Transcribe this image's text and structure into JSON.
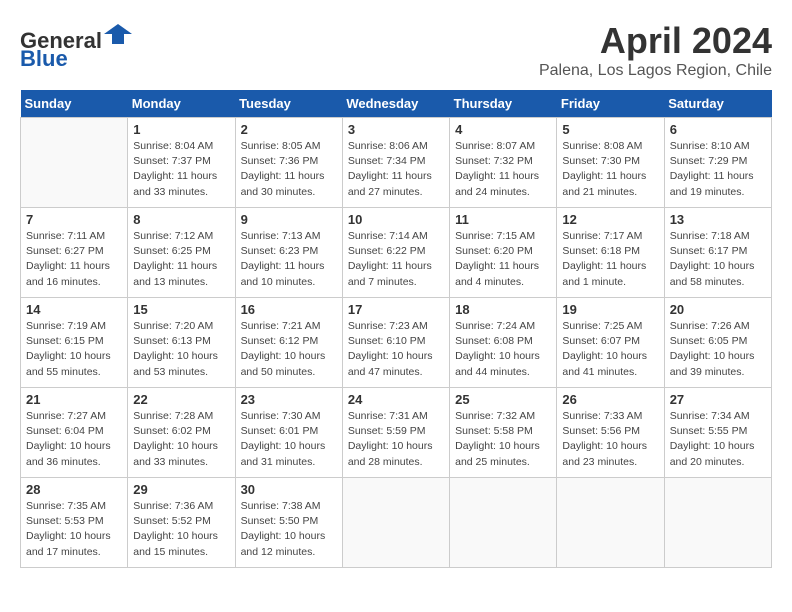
{
  "header": {
    "logo_line1": "General",
    "logo_line2": "Blue",
    "month": "April 2024",
    "location": "Palena, Los Lagos Region, Chile"
  },
  "weekdays": [
    "Sunday",
    "Monday",
    "Tuesday",
    "Wednesday",
    "Thursday",
    "Friday",
    "Saturday"
  ],
  "weeks": [
    [
      {
        "day": "",
        "info": ""
      },
      {
        "day": "1",
        "info": "Sunrise: 8:04 AM\nSunset: 7:37 PM\nDaylight: 11 hours\nand 33 minutes."
      },
      {
        "day": "2",
        "info": "Sunrise: 8:05 AM\nSunset: 7:36 PM\nDaylight: 11 hours\nand 30 minutes."
      },
      {
        "day": "3",
        "info": "Sunrise: 8:06 AM\nSunset: 7:34 PM\nDaylight: 11 hours\nand 27 minutes."
      },
      {
        "day": "4",
        "info": "Sunrise: 8:07 AM\nSunset: 7:32 PM\nDaylight: 11 hours\nand 24 minutes."
      },
      {
        "day": "5",
        "info": "Sunrise: 8:08 AM\nSunset: 7:30 PM\nDaylight: 11 hours\nand 21 minutes."
      },
      {
        "day": "6",
        "info": "Sunrise: 8:10 AM\nSunset: 7:29 PM\nDaylight: 11 hours\nand 19 minutes."
      }
    ],
    [
      {
        "day": "7",
        "info": "Sunrise: 7:11 AM\nSunset: 6:27 PM\nDaylight: 11 hours\nand 16 minutes."
      },
      {
        "day": "8",
        "info": "Sunrise: 7:12 AM\nSunset: 6:25 PM\nDaylight: 11 hours\nand 13 minutes."
      },
      {
        "day": "9",
        "info": "Sunrise: 7:13 AM\nSunset: 6:23 PM\nDaylight: 11 hours\nand 10 minutes."
      },
      {
        "day": "10",
        "info": "Sunrise: 7:14 AM\nSunset: 6:22 PM\nDaylight: 11 hours\nand 7 minutes."
      },
      {
        "day": "11",
        "info": "Sunrise: 7:15 AM\nSunset: 6:20 PM\nDaylight: 11 hours\nand 4 minutes."
      },
      {
        "day": "12",
        "info": "Sunrise: 7:17 AM\nSunset: 6:18 PM\nDaylight: 11 hours\nand 1 minute."
      },
      {
        "day": "13",
        "info": "Sunrise: 7:18 AM\nSunset: 6:17 PM\nDaylight: 10 hours\nand 58 minutes."
      }
    ],
    [
      {
        "day": "14",
        "info": "Sunrise: 7:19 AM\nSunset: 6:15 PM\nDaylight: 10 hours\nand 55 minutes."
      },
      {
        "day": "15",
        "info": "Sunrise: 7:20 AM\nSunset: 6:13 PM\nDaylight: 10 hours\nand 53 minutes."
      },
      {
        "day": "16",
        "info": "Sunrise: 7:21 AM\nSunset: 6:12 PM\nDaylight: 10 hours\nand 50 minutes."
      },
      {
        "day": "17",
        "info": "Sunrise: 7:23 AM\nSunset: 6:10 PM\nDaylight: 10 hours\nand 47 minutes."
      },
      {
        "day": "18",
        "info": "Sunrise: 7:24 AM\nSunset: 6:08 PM\nDaylight: 10 hours\nand 44 minutes."
      },
      {
        "day": "19",
        "info": "Sunrise: 7:25 AM\nSunset: 6:07 PM\nDaylight: 10 hours\nand 41 minutes."
      },
      {
        "day": "20",
        "info": "Sunrise: 7:26 AM\nSunset: 6:05 PM\nDaylight: 10 hours\nand 39 minutes."
      }
    ],
    [
      {
        "day": "21",
        "info": "Sunrise: 7:27 AM\nSunset: 6:04 PM\nDaylight: 10 hours\nand 36 minutes."
      },
      {
        "day": "22",
        "info": "Sunrise: 7:28 AM\nSunset: 6:02 PM\nDaylight: 10 hours\nand 33 minutes."
      },
      {
        "day": "23",
        "info": "Sunrise: 7:30 AM\nSunset: 6:01 PM\nDaylight: 10 hours\nand 31 minutes."
      },
      {
        "day": "24",
        "info": "Sunrise: 7:31 AM\nSunset: 5:59 PM\nDaylight: 10 hours\nand 28 minutes."
      },
      {
        "day": "25",
        "info": "Sunrise: 7:32 AM\nSunset: 5:58 PM\nDaylight: 10 hours\nand 25 minutes."
      },
      {
        "day": "26",
        "info": "Sunrise: 7:33 AM\nSunset: 5:56 PM\nDaylight: 10 hours\nand 23 minutes."
      },
      {
        "day": "27",
        "info": "Sunrise: 7:34 AM\nSunset: 5:55 PM\nDaylight: 10 hours\nand 20 minutes."
      }
    ],
    [
      {
        "day": "28",
        "info": "Sunrise: 7:35 AM\nSunset: 5:53 PM\nDaylight: 10 hours\nand 17 minutes."
      },
      {
        "day": "29",
        "info": "Sunrise: 7:36 AM\nSunset: 5:52 PM\nDaylight: 10 hours\nand 15 minutes."
      },
      {
        "day": "30",
        "info": "Sunrise: 7:38 AM\nSunset: 5:50 PM\nDaylight: 10 hours\nand 12 minutes."
      },
      {
        "day": "",
        "info": ""
      },
      {
        "day": "",
        "info": ""
      },
      {
        "day": "",
        "info": ""
      },
      {
        "day": "",
        "info": ""
      }
    ]
  ]
}
